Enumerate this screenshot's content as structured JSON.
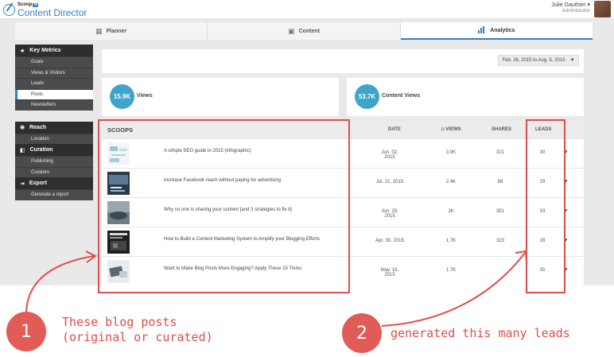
{
  "app": {
    "logo_small": "Scoop",
    "logo_badge": "it",
    "logo_big": "Content Director"
  },
  "user": {
    "name": "Julie Gauthier ▾",
    "role": "Administrator"
  },
  "tabs": [
    {
      "label": "Planner",
      "icon": "calendar-icon",
      "active": false
    },
    {
      "label": "Content",
      "icon": "content-icon",
      "active": false
    },
    {
      "label": "Analytics",
      "icon": "bar-chart-icon",
      "active": true
    }
  ],
  "sidebar": {
    "key_metrics": {
      "label": "Key Metrics",
      "items": [
        "Goals",
        "Views & Visitors",
        "Leads",
        "Posts",
        "Newsletters"
      ],
      "active": "Posts"
    },
    "reach": {
      "label": "Reach",
      "items": [
        "Location"
      ]
    },
    "curation": {
      "label": "Curation",
      "items": [
        "Publishing",
        "Curators"
      ]
    },
    "export": {
      "label": "Export",
      "items": [
        "Generate a report"
      ]
    }
  },
  "date_range": "Feb. 26, 2015 to Aug. 5, 2015",
  "metrics": {
    "views": {
      "value": "15.9K",
      "label": "Views"
    },
    "content_views": {
      "value": "53.7K",
      "label": "Content Views"
    }
  },
  "table": {
    "headers": {
      "scoops": "SCOOPS",
      "date": "DATE",
      "views": "VIEWS",
      "shares": "SHARES",
      "leads": "LEADS"
    },
    "rows": [
      {
        "title": "A simple SEO guide in 2015 (infographic)",
        "date": "Jun. 02, 2015",
        "views": "3.9K",
        "shares": "321",
        "leads": "30"
      },
      {
        "title": "Increase Facebook reach without paying for advertising",
        "date": "Jul. 21, 2015",
        "views": "2.4K",
        "shares": "88",
        "leads": "29"
      },
      {
        "title": "Why no one is sharing your content [and 3 strategies to fix it]",
        "date": "Jun. 29, 2015",
        "views": "2K",
        "shares": "351",
        "leads": "33"
      },
      {
        "title": "How to Build a Content Marketing System to Amplify your Blogging Efforts",
        "date": "Apr. 30, 2015",
        "views": "1.7K",
        "shares": "323",
        "leads": "28"
      },
      {
        "title": "Want to Make Blog Posts More Engaging? Apply These 15 Tricks",
        "date": "May. 18, 2015",
        "views": "1.7K",
        "shares": "",
        "leads": "35"
      }
    ]
  },
  "annotations": {
    "one": {
      "number": "1",
      "line1": "These blog posts",
      "line2": "(original or curated)"
    },
    "two": {
      "number": "2",
      "line1": "generated this many leads"
    }
  },
  "colors": {
    "accent": "#3b7fb8",
    "metric_circle": "#3fa4c9",
    "annotation_red": "#e14d4a"
  }
}
